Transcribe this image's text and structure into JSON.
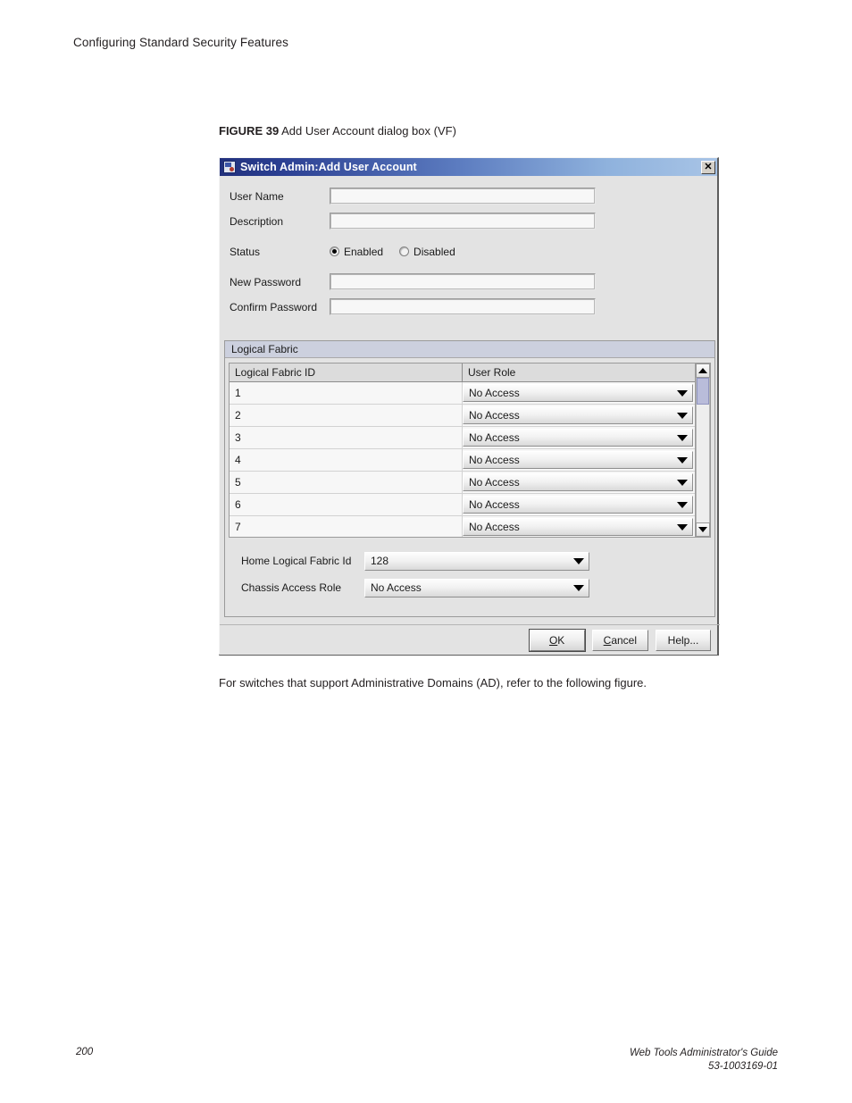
{
  "page": {
    "running_header": "Configuring Standard Security Features",
    "body_paragraph": "For switches that support Administrative Domains (AD), refer to the following figure.",
    "footer": {
      "page_number": "200",
      "guide_title": "Web Tools Administrator's Guide",
      "doc_number": "53-1003169-01"
    }
  },
  "figure": {
    "label": "FIGURE 39",
    "caption": " Add User Account dialog box (VF)"
  },
  "dialog": {
    "title": "Switch Admin:Add User Account",
    "icon": "app-window-icon",
    "close_label": "✕",
    "fields": [
      {
        "label": "User Name",
        "value": "",
        "placeholder": ""
      },
      {
        "label": "Description",
        "value": "",
        "placeholder": ""
      }
    ],
    "status": {
      "label": "Status",
      "options": [
        {
          "label": "Enabled",
          "selected": true
        },
        {
          "label": "Disabled",
          "selected": false
        }
      ]
    },
    "passwords": [
      {
        "label": "New Password",
        "value": "",
        "placeholder": ""
      },
      {
        "label": "Confirm Password",
        "value": "",
        "placeholder": ""
      }
    ],
    "fabric_panel": {
      "title": "Logical Fabric",
      "columns": [
        "Logical Fabric ID",
        "User Role"
      ],
      "rows": [
        {
          "id": "1",
          "role": "No Access"
        },
        {
          "id": "2",
          "role": "No Access"
        },
        {
          "id": "3",
          "role": "No Access"
        },
        {
          "id": "4",
          "role": "No Access"
        },
        {
          "id": "5",
          "role": "No Access"
        },
        {
          "id": "6",
          "role": "No Access"
        },
        {
          "id": "7",
          "role": "No Access"
        }
      ],
      "scrollbar": {
        "up_icon": "scroll-up-arrow-icon",
        "down_icon": "scroll-down-arrow-icon"
      },
      "home_fabric": {
        "label": "Home Logical Fabric Id",
        "value": "128"
      },
      "chassis_role": {
        "label": "Chassis Access Role",
        "value": "No Access"
      }
    },
    "buttons": {
      "ok": {
        "mnemonic": "O",
        "rest": "K"
      },
      "cancel": {
        "mnemonic": "C",
        "rest": "ancel"
      },
      "help": "Help..."
    }
  },
  "colors": {
    "titlebar_start": "#21307c",
    "titlebar_end": "#a8c4e6",
    "dialog_face": "#e3e3e3",
    "panel_header": "#ccd0de",
    "scroll_thumb": "#b9bcda"
  }
}
